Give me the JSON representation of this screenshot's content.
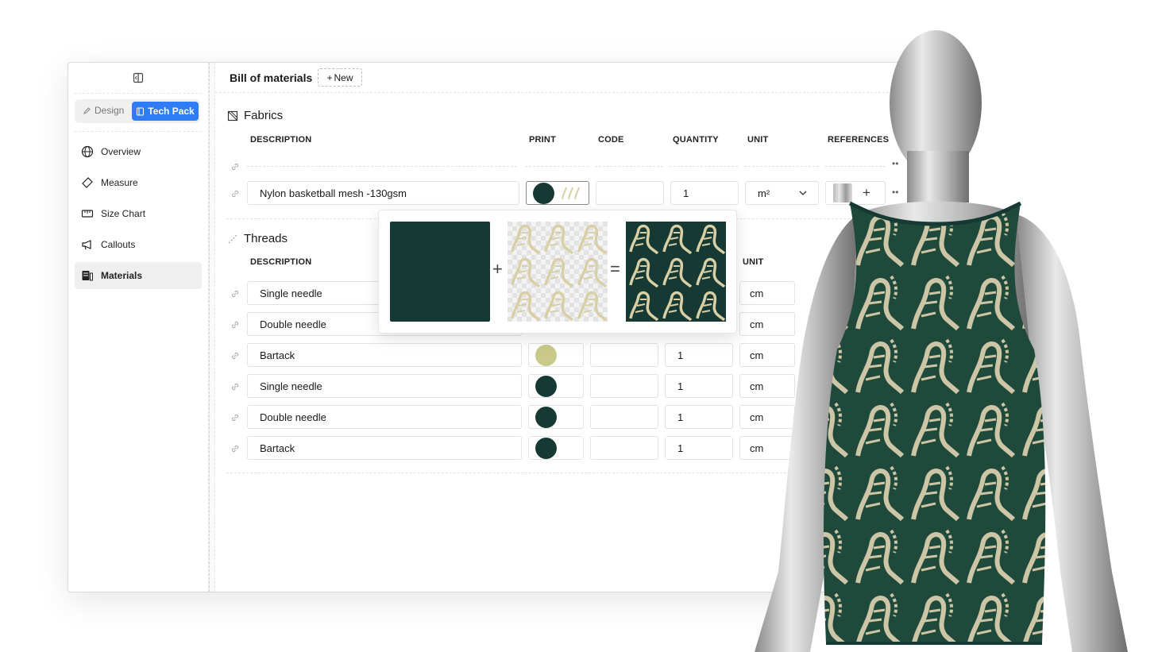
{
  "topbar": {
    "title": "Bill of materials",
    "new_label": "New",
    "plus": "+"
  },
  "sidebar": {
    "segments": {
      "design": "Design",
      "techpack": "Tech Pack"
    },
    "items": [
      {
        "label": "Overview",
        "icon": "globe-icon"
      },
      {
        "label": "Measure",
        "icon": "ruler-icon"
      },
      {
        "label": "Size Chart",
        "icon": "size-chart-icon"
      },
      {
        "label": "Callouts",
        "icon": "megaphone-icon"
      },
      {
        "label": "Materials",
        "icon": "materials-icon",
        "active": true
      }
    ]
  },
  "fabrics": {
    "title": "Fabrics",
    "columns": {
      "description": "DESCRIPTION",
      "print": "PRINT",
      "code": "CODE",
      "quantity": "QUANTITY",
      "unit": "UNIT",
      "references": "REFERENCES"
    },
    "rows": [
      {
        "description": "Nylon basketball mesh -130gsm",
        "quantity": "1",
        "unit": "m²"
      }
    ]
  },
  "threads": {
    "title": "Threads",
    "columns": {
      "description": "DESCRIPTION",
      "unit": "UNIT"
    },
    "rows": [
      {
        "description": "Single needle",
        "quantity": "",
        "unit": "cm",
        "color": ""
      },
      {
        "description": "Double needle",
        "quantity": "",
        "unit": "cm",
        "color": ""
      },
      {
        "description": "Bartack",
        "quantity": "1",
        "unit": "cm",
        "color": "#c9c98a"
      },
      {
        "description": "Single needle",
        "quantity": "1",
        "unit": "cm",
        "color": "#163a33"
      },
      {
        "description": "Double needle",
        "quantity": "1",
        "unit": "cm",
        "color": "#163a33"
      },
      {
        "description": "Bartack",
        "quantity": "1",
        "unit": "cm",
        "color": "#163a33"
      }
    ]
  },
  "popup": {
    "plus": "+",
    "equals": "="
  },
  "colors": {
    "accent": "#2f7cf6",
    "fabric_green": "#163a33",
    "print_cream": "#d8cfa6"
  }
}
